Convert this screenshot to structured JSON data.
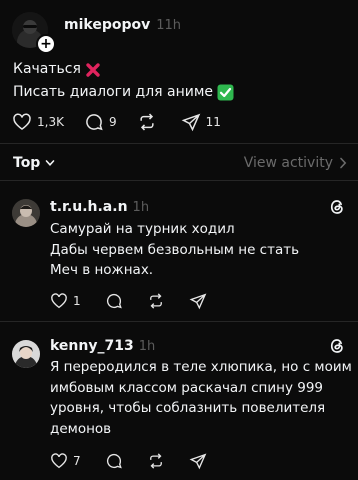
{
  "post": {
    "author": "mikepopov",
    "time": "11h",
    "lines": [
      {
        "text": "Качаться",
        "emoji": "❌",
        "emoji_color": "#e0245e"
      },
      {
        "text": "Писать диалоги для аниме",
        "emoji": "✅",
        "emoji_color": "#2fb84f"
      }
    ],
    "actions": {
      "likes": "1,3K",
      "replies": "9",
      "repost": "",
      "shares": "11"
    }
  },
  "sort": {
    "label": "Top",
    "view_activity": "View activity"
  },
  "replies": [
    {
      "author": "t.r.u.h.a.n",
      "time": "1h",
      "lines": [
        "Самурай на турник ходил",
        "Дабы червем безвольным не стать",
        "Меч в ножнах."
      ],
      "likes": "1"
    },
    {
      "author": "kenny_713",
      "time": "1h",
      "lines": [
        "Я переродился в теле хлюпика, но с моим",
        "имбовым классом раскачал спину 999",
        "уровня, чтобы соблазнить повелителя",
        "демонов"
      ],
      "likes": "7"
    }
  ],
  "colors": {
    "background": "#0b0b0b",
    "text": "#f3f5f7",
    "muted": "#6b6b6b",
    "divider": "#262626"
  }
}
